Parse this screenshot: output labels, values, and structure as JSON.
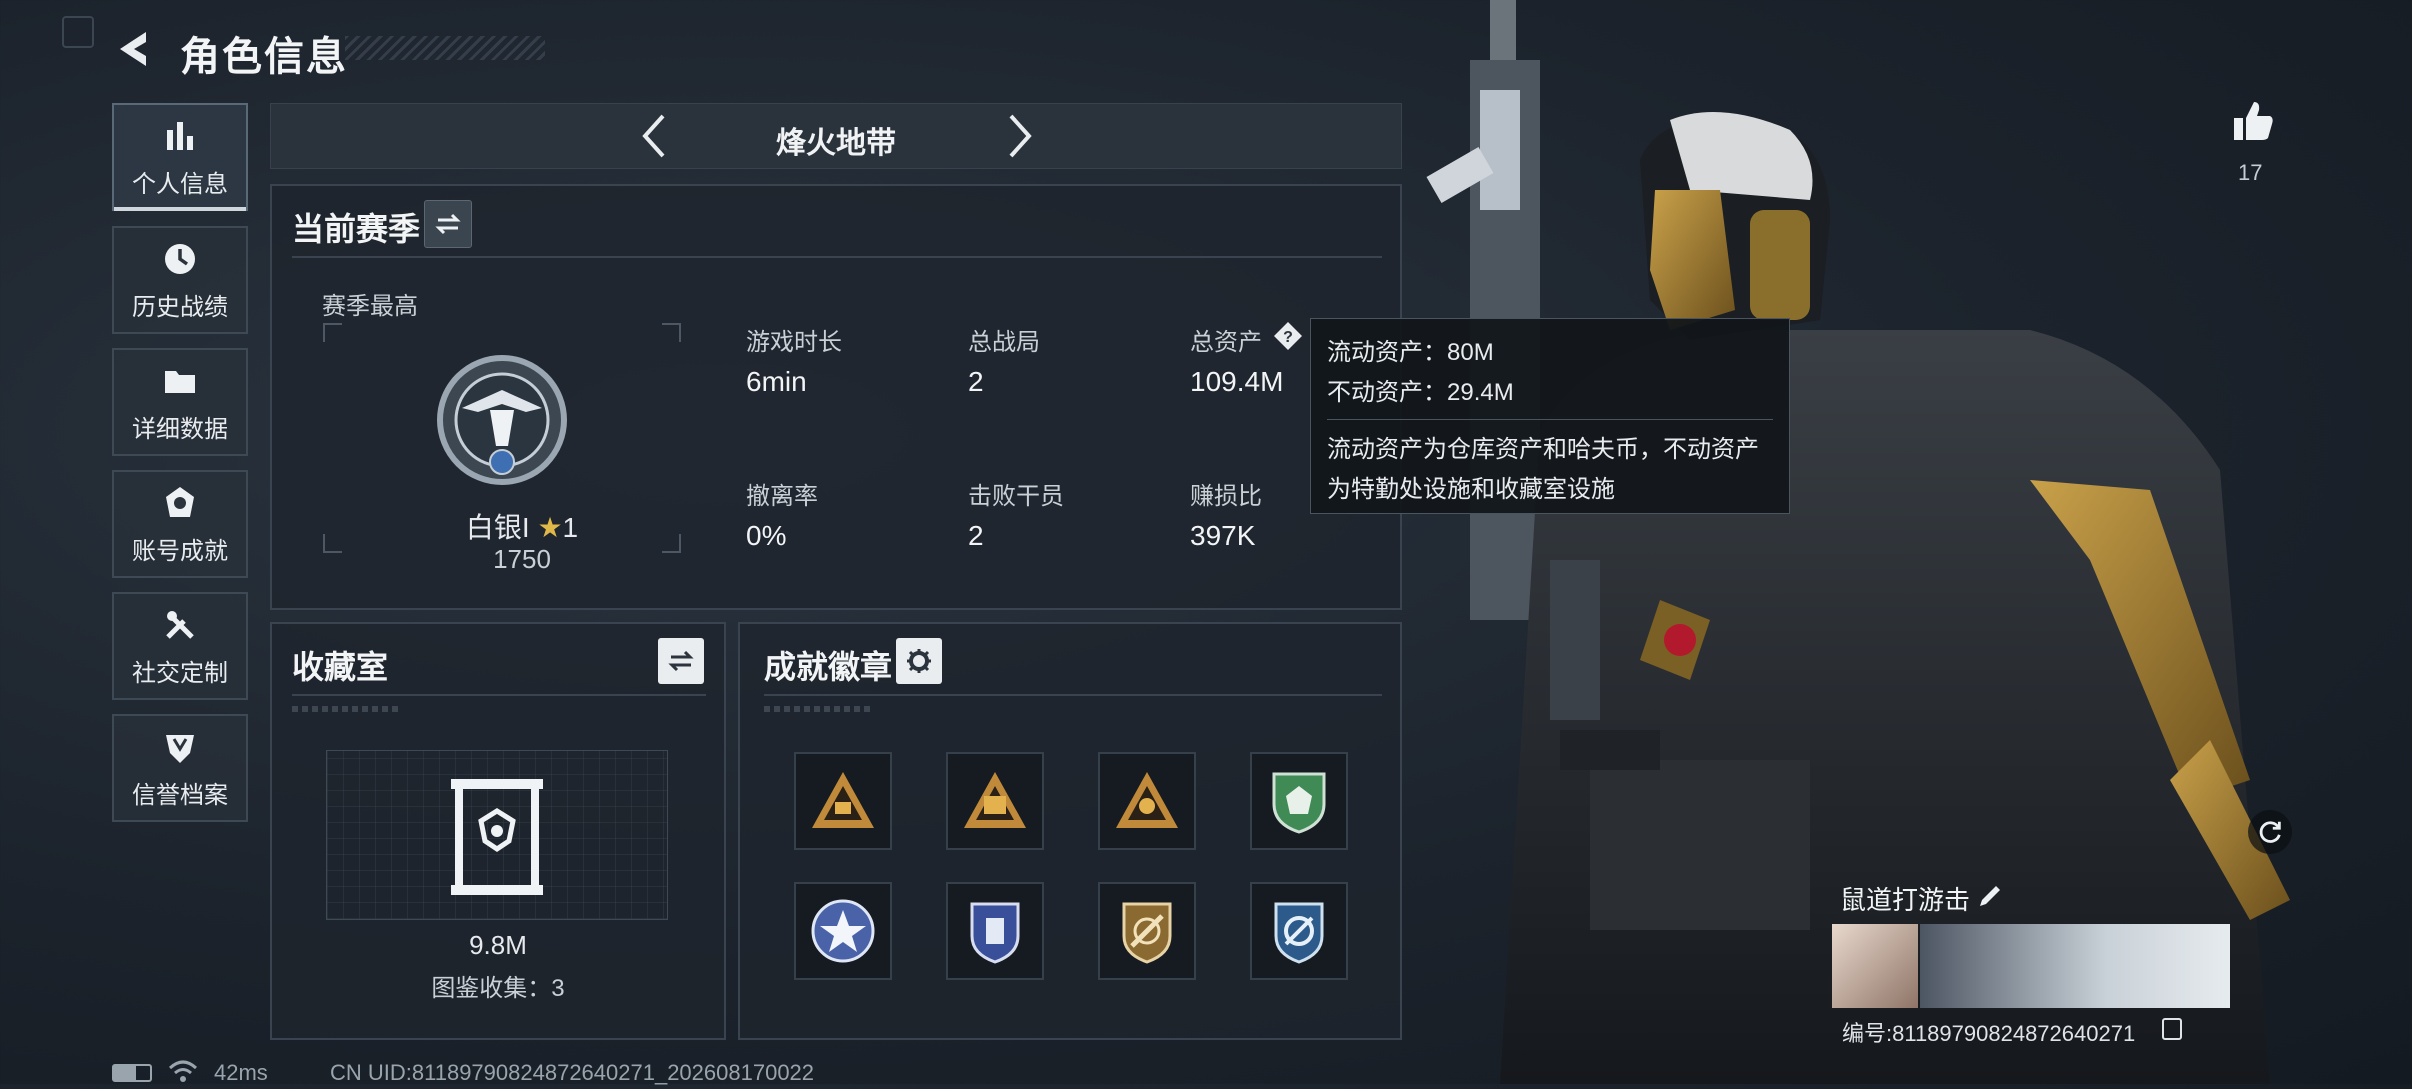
{
  "header": {
    "title": "角色信息"
  },
  "sidebar": {
    "items": [
      {
        "label": "个人信息",
        "icon": "bar-chart-icon",
        "active": true
      },
      {
        "label": "历史战绩",
        "icon": "history-clock-icon"
      },
      {
        "label": "详细数据",
        "icon": "folder-icon"
      },
      {
        "label": "账号成就",
        "icon": "achievement-icon"
      },
      {
        "label": "社交定制",
        "icon": "tools-icon"
      },
      {
        "label": "信誉档案",
        "icon": "credibility-icon"
      }
    ]
  },
  "zone": {
    "name": "烽火地带"
  },
  "season": {
    "title": "当前赛季",
    "best_label": "赛季最高",
    "rank_name": "白银I",
    "rank_stars": "1",
    "rank_score": "1750",
    "stats": [
      {
        "label": "游戏时长",
        "value": "6min"
      },
      {
        "label": "总战局",
        "value": "2"
      },
      {
        "label": "总资产",
        "value": "109.4M"
      },
      {
        "label": "撤离率",
        "value": "0%"
      },
      {
        "label": "击败干员",
        "value": "2"
      },
      {
        "label": "赚损比",
        "value": "397K"
      }
    ]
  },
  "tooltip": {
    "liquid": "流动资产：80M",
    "fixed": "不动资产：29.4M",
    "desc_line1": "流动资产为仓库资产和哈夫币，不动资产",
    "desc_line2": "为特勤处设施和收藏室设施"
  },
  "collection": {
    "title": "收藏室",
    "value": "9.8M",
    "catalog": "图鉴收集：3"
  },
  "badges": {
    "title": "成就徽章",
    "items": [
      {
        "icon": "triangle-badge-icon",
        "color": "#c08a3a"
      },
      {
        "icon": "triangle-badge-icon",
        "color": "#c08a3a"
      },
      {
        "icon": "triangle-badge-icon",
        "color": "#c08a3a"
      },
      {
        "icon": "shield-badge-icon",
        "color": "#3f8a55"
      },
      {
        "icon": "star-badge-icon",
        "color": "#4a63a8"
      },
      {
        "icon": "shield-badge-icon",
        "color": "#3a4f9a"
      },
      {
        "icon": "shield-badge-icon",
        "color": "#8a6a30"
      },
      {
        "icon": "shield-badge-icon",
        "color": "#2c5a8a"
      }
    ]
  },
  "like": {
    "count": "17"
  },
  "player": {
    "name": "鼠道打游击",
    "id_line": "编号:811897908248726402​71"
  },
  "footer": {
    "ping": "42ms",
    "uid": "CN UID:811897908248726402​71_202608170022"
  }
}
